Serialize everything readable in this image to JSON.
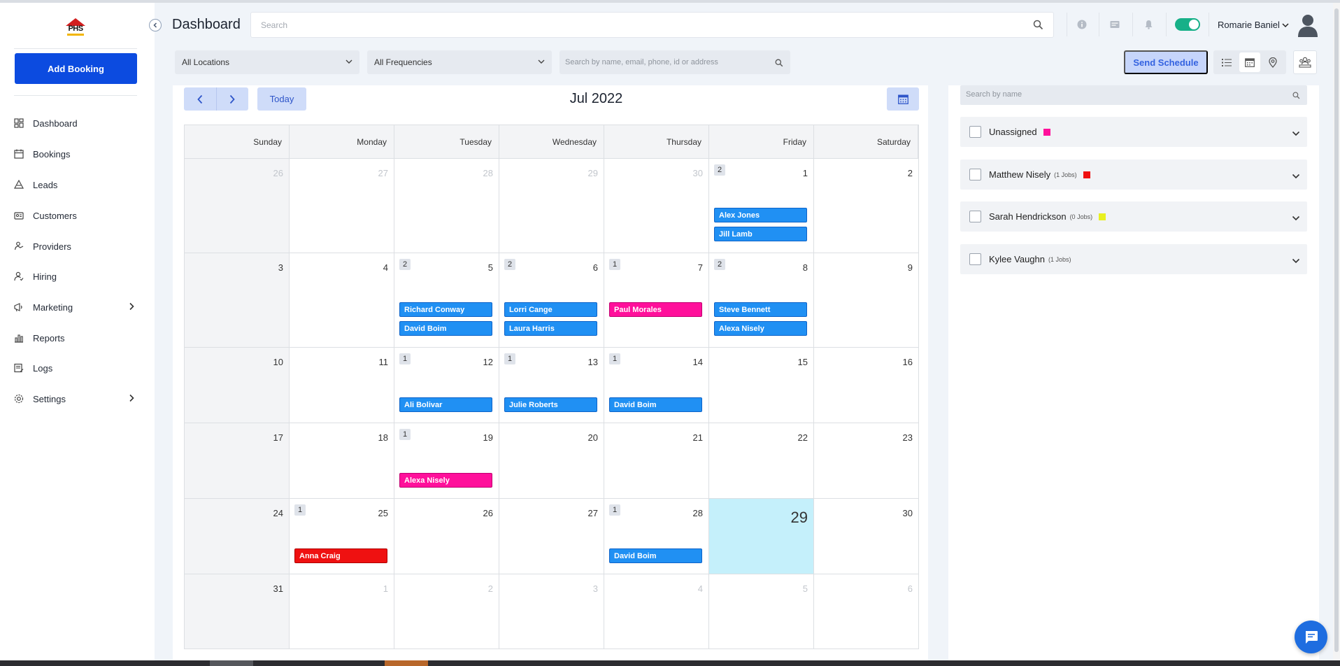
{
  "app": {
    "logo_text": "PHS"
  },
  "sidebar": {
    "add_booking": "Add Booking",
    "items": [
      {
        "label": "Dashboard",
        "icon": "dashboard-icon"
      },
      {
        "label": "Bookings",
        "icon": "bookings-icon"
      },
      {
        "label": "Leads",
        "icon": "leads-icon"
      },
      {
        "label": "Customers",
        "icon": "customers-icon"
      },
      {
        "label": "Providers",
        "icon": "providers-icon"
      },
      {
        "label": "Hiring",
        "icon": "hiring-icon"
      },
      {
        "label": "Marketing",
        "icon": "marketing-icon",
        "has_submenu": true
      },
      {
        "label": "Reports",
        "icon": "reports-icon"
      },
      {
        "label": "Logs",
        "icon": "logs-icon"
      },
      {
        "label": "Settings",
        "icon": "settings-icon",
        "has_submenu": true
      }
    ]
  },
  "header": {
    "title": "Dashboard",
    "search_placeholder": "Search",
    "user_name": "Romarie Baniel",
    "toggle_on": true
  },
  "filters": {
    "location": "All Locations",
    "frequency": "All Frequencies",
    "search_placeholder": "Search by name, email, phone, id or address",
    "send_schedule": "Send Schedule"
  },
  "calendar": {
    "month_title": "Jul 2022",
    "today_label": "Today",
    "weekdays": [
      "Sunday",
      "Monday",
      "Tuesday",
      "Wednesday",
      "Thursday",
      "Friday",
      "Saturday"
    ],
    "weeks": [
      [
        {
          "day": "26",
          "muted": true
        },
        {
          "day": "27",
          "muted": true
        },
        {
          "day": "28",
          "muted": true
        },
        {
          "day": "29",
          "muted": true
        },
        {
          "day": "30",
          "muted": true
        },
        {
          "day": "1",
          "count": "2",
          "events": [
            {
              "name": "Alex Jones",
              "color": "blue"
            },
            {
              "name": "Jill Lamb",
              "color": "blue"
            }
          ]
        },
        {
          "day": "2"
        }
      ],
      [
        {
          "day": "3"
        },
        {
          "day": "4"
        },
        {
          "day": "5",
          "count": "2",
          "events": [
            {
              "name": "Richard Conway",
              "color": "blue"
            },
            {
              "name": "David Boim",
              "color": "blue"
            }
          ]
        },
        {
          "day": "6",
          "count": "2",
          "events": [
            {
              "name": "Lorri Cange",
              "color": "blue"
            },
            {
              "name": "Laura Harris",
              "color": "blue"
            }
          ]
        },
        {
          "day": "7",
          "count": "1",
          "events": [
            {
              "name": "Paul Morales",
              "color": "pink"
            }
          ]
        },
        {
          "day": "8",
          "count": "2",
          "events": [
            {
              "name": "Steve Bennett",
              "color": "blue"
            },
            {
              "name": "Alexa Nisely",
              "color": "blue"
            }
          ]
        },
        {
          "day": "9"
        }
      ],
      [
        {
          "day": "10"
        },
        {
          "day": "11"
        },
        {
          "day": "12",
          "count": "1",
          "events": [
            {
              "name": "Ali Bolivar",
              "color": "blue"
            }
          ]
        },
        {
          "day": "13",
          "count": "1",
          "events": [
            {
              "name": "Julie Roberts",
              "color": "blue"
            }
          ]
        },
        {
          "day": "14",
          "count": "1",
          "events": [
            {
              "name": "David Boim",
              "color": "blue"
            }
          ]
        },
        {
          "day": "15"
        },
        {
          "day": "16"
        }
      ],
      [
        {
          "day": "17"
        },
        {
          "day": "18"
        },
        {
          "day": "19",
          "count": "1",
          "events": [
            {
              "name": "Alexa Nisely",
              "color": "pink"
            }
          ]
        },
        {
          "day": "20"
        },
        {
          "day": "21"
        },
        {
          "day": "22"
        },
        {
          "day": "23"
        }
      ],
      [
        {
          "day": "24"
        },
        {
          "day": "25",
          "count": "1",
          "events": [
            {
              "name": "Anna Craig",
              "color": "red"
            }
          ]
        },
        {
          "day": "26"
        },
        {
          "day": "27"
        },
        {
          "day": "28",
          "count": "1",
          "events": [
            {
              "name": "David Boim",
              "color": "blue"
            }
          ]
        },
        {
          "day": "29",
          "today": true
        },
        {
          "day": "30"
        }
      ],
      [
        {
          "day": "31"
        },
        {
          "day": "1",
          "muted": true
        },
        {
          "day": "2",
          "muted": true
        },
        {
          "day": "3",
          "muted": true
        },
        {
          "day": "4",
          "muted": true
        },
        {
          "day": "5",
          "muted": true
        },
        {
          "day": "6",
          "muted": true
        }
      ]
    ]
  },
  "providers_panel": {
    "search_placeholder": "Search by name",
    "providers": [
      {
        "name": "Unassigned",
        "jobs": "",
        "color": "#ff109b"
      },
      {
        "name": "Matthew Nisely",
        "jobs": "(1 Jobs)",
        "color": "#ef1111"
      },
      {
        "name": "Sarah Hendrickson",
        "jobs": "(0 Jobs)",
        "color": "#e8f020"
      },
      {
        "name": "Kylee Vaughn",
        "jobs": "(1 Jobs)",
        "color": ""
      }
    ]
  },
  "colors": {
    "primary": "#0c4be0",
    "event_blue": "#2090f3",
    "event_pink": "#ff109b",
    "event_red": "#ef1111",
    "today_cell": "#c5f0fb",
    "toggle": "#17b088"
  }
}
